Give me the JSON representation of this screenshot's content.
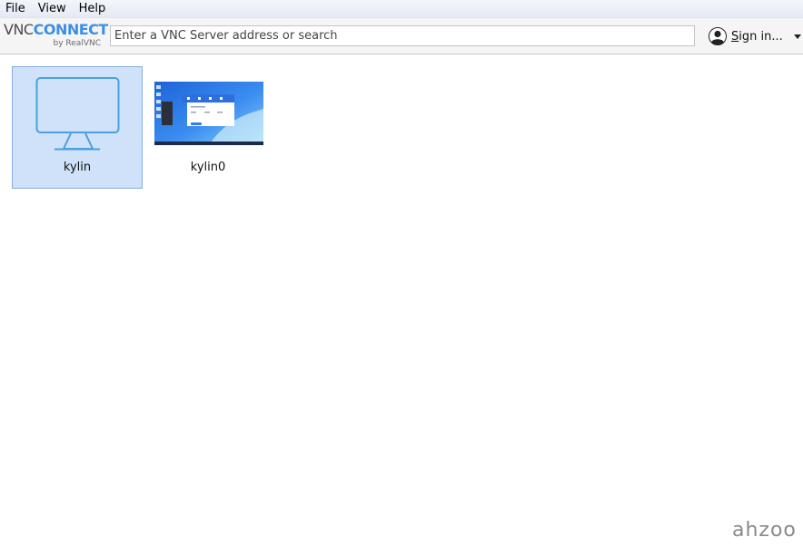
{
  "menu": {
    "items": [
      "File",
      "View",
      "Help"
    ]
  },
  "logo": {
    "vnc": "VNC",
    "connect": "CONNECT",
    "sub": "by RealVNC"
  },
  "search": {
    "placeholder": "Enter a VNC Server address or search",
    "value": ""
  },
  "account": {
    "signin_first": "S",
    "signin_rest": "ign in..."
  },
  "tiles": [
    {
      "label": "kylin",
      "icon": "monitor-icon",
      "selected": true
    },
    {
      "label": "kylin0",
      "icon": "desktop-thumbnail",
      "selected": false
    }
  ],
  "watermark": "ahzoo",
  "colors": {
    "accent": "#3c8ee6",
    "selection": "#cfe2f9",
    "selection_border": "#85ade0"
  }
}
